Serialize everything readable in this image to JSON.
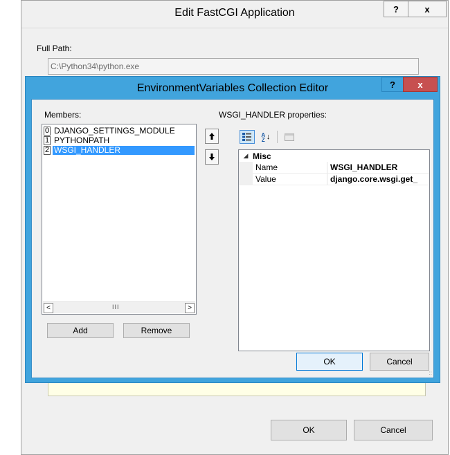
{
  "outer": {
    "title": "Edit FastCGI Application",
    "help_label": "?",
    "close_label": "x",
    "full_path_label": "Full Path:",
    "full_path_value": "C:\\Python34\\python.exe",
    "ok_label": "OK",
    "cancel_label": "Cancel"
  },
  "inner": {
    "title": "EnvironmentVariables Collection Editor",
    "help_label": "?",
    "close_label": "x",
    "members_label": "Members:",
    "members": [
      {
        "index": "0",
        "name": "DJANGO_SETTINGS_MODULE",
        "selected": false
      },
      {
        "index": "1",
        "name": "PYTHONPATH",
        "selected": false
      },
      {
        "index": "2",
        "name": "WSGI_HANDLER",
        "selected": true
      }
    ],
    "scroll_left": "<",
    "scroll_right": ">",
    "scroll_grip": "III",
    "move_up": "↑",
    "move_down": "↓",
    "add_label": "Add",
    "remove_label": "Remove",
    "properties_label": "WSGI_HANDLER properties:",
    "toolbar": {
      "categorized_icon": "categorized-icon",
      "alphabetical_icon": "alphabetical-icon",
      "alphabetical_glyph": "↓",
      "alphabetical_text": "AZ",
      "property_pages_icon": "property-pages-icon"
    },
    "category": {
      "toggle": "◢",
      "name": "Misc"
    },
    "properties": [
      {
        "name": "Name",
        "value": "WSGI_HANDLER"
      },
      {
        "name": "Value",
        "value": "django.core.wsgi.get_"
      }
    ],
    "ok_label": "OK",
    "cancel_label": "Cancel",
    "size_grip": "::"
  },
  "colors": {
    "accent_frame": "#41a4dd",
    "selection": "#3399ff",
    "close_red": "#c75050"
  }
}
